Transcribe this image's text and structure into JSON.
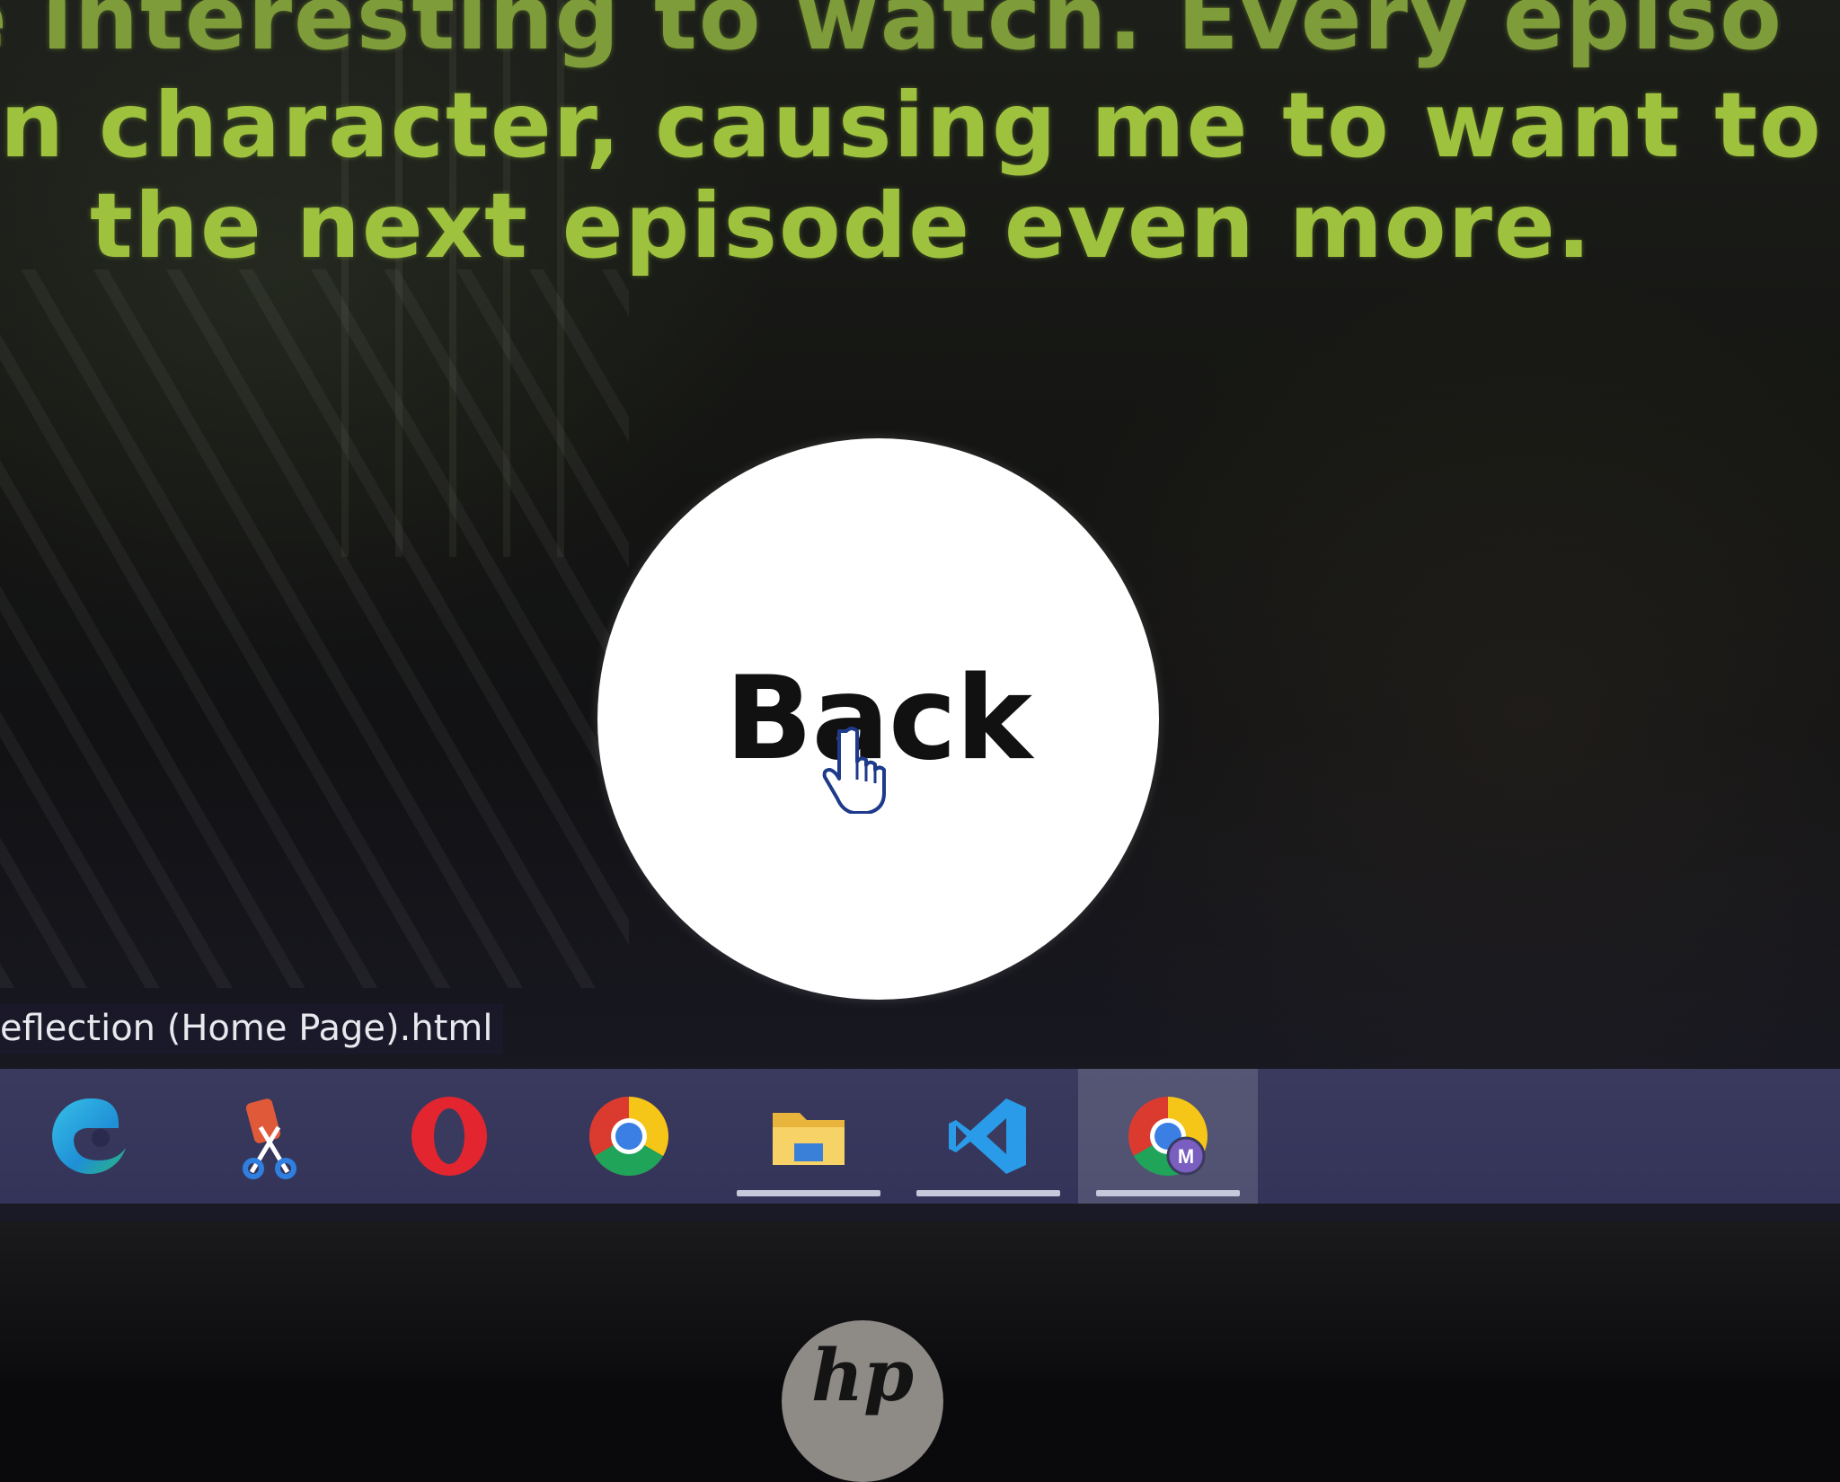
{
  "page": {
    "quote_lines": [
      "e interesting to watch. Every episo",
      "n character, causing me to want to",
      "the next episode even more."
    ],
    "back_button_label": "Back"
  },
  "browser_status": {
    "url": "eflection (Home Page).html"
  },
  "taskbar": {
    "items": [
      {
        "name": "edge-icon",
        "running": false,
        "active": false
      },
      {
        "name": "snip-sketch-icon",
        "running": false,
        "active": false
      },
      {
        "name": "opera-icon",
        "running": false,
        "active": false
      },
      {
        "name": "chrome-icon",
        "running": false,
        "active": false
      },
      {
        "name": "file-explorer-icon",
        "running": true,
        "active": false
      },
      {
        "name": "vscode-icon",
        "running": true,
        "active": false
      },
      {
        "name": "chrome-profile-icon",
        "running": true,
        "active": true,
        "profile_initial": "M"
      }
    ]
  },
  "bezel": {
    "logo": "hp"
  },
  "colors": {
    "quote_text": "#9fc23e",
    "button_bg": "#ffffff",
    "taskbar_bg": "#3a3a5e"
  }
}
